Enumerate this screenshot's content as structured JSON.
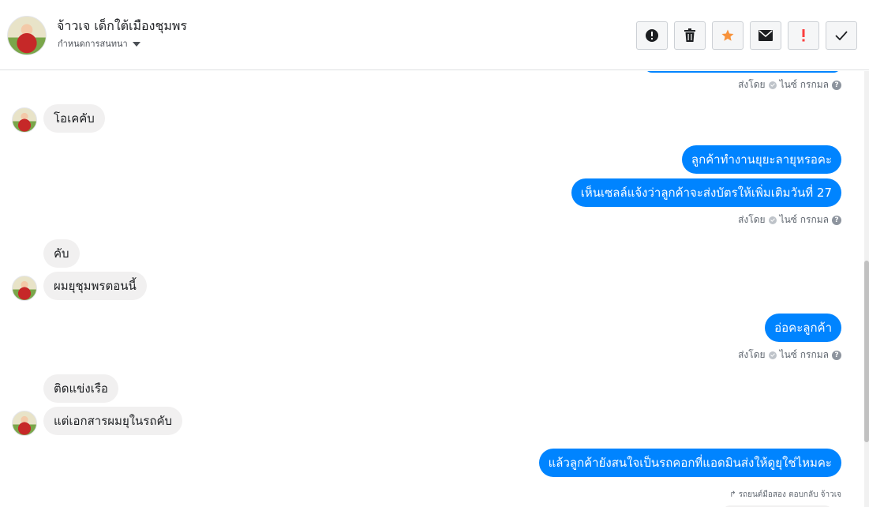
{
  "header": {
    "name": "จ้าวเจ เด็กใต้เมืองชุมพร",
    "subtitle": "กำหนดการสนทนา"
  },
  "toolbar": [
    {
      "name": "report-button",
      "icon": "alert-circle-icon",
      "color": "#1c1e21"
    },
    {
      "name": "delete-button",
      "icon": "trash-icon",
      "color": "#1c1e21"
    },
    {
      "name": "star-button",
      "icon": "star-icon",
      "color": "#f7923b"
    },
    {
      "name": "mark-unread-button",
      "icon": "envelope-icon",
      "color": "#1c1e21"
    },
    {
      "name": "important-button",
      "icon": "exclamation-icon",
      "color": "#fa3e3e"
    },
    {
      "name": "mark-done-button",
      "icon": "check-icon",
      "color": "#1c1e21"
    }
  ],
  "messages": {
    "sent_by_label": "ส่งโดย",
    "sender_name": "ไนซ์ กรกมล",
    "in1": "โอเคคับ",
    "out1": "ลูกค้าทำงานยุยะลายุหรอคะ",
    "out2": "เห็นเซลล์แจ้งว่าลูกค้าจะส่งบัตรให้เพิ่มเติมวันที่ 27",
    "in2": "คับ",
    "in3": "ผมยุชุมพรตอนนี้",
    "out3": "อ่อคะลูกค้า",
    "in4": "ติดแข่งเรือ",
    "in5": "แต่เอกสารผมยุในรถคับ",
    "out4": "แล้วลูกค้ายังสนใจเป็นรถคอกที่แอดมินส่งให้ดูยุใช่ไหมคะ",
    "reply_note": "รถยนต์มือสอง ตอบกลับ จ้าวเจ"
  },
  "colors": {
    "outgoing_bubble": "#0084ff",
    "incoming_bubble": "#f1f0f0",
    "star": "#f7923b",
    "important": "#fa3e3e"
  }
}
